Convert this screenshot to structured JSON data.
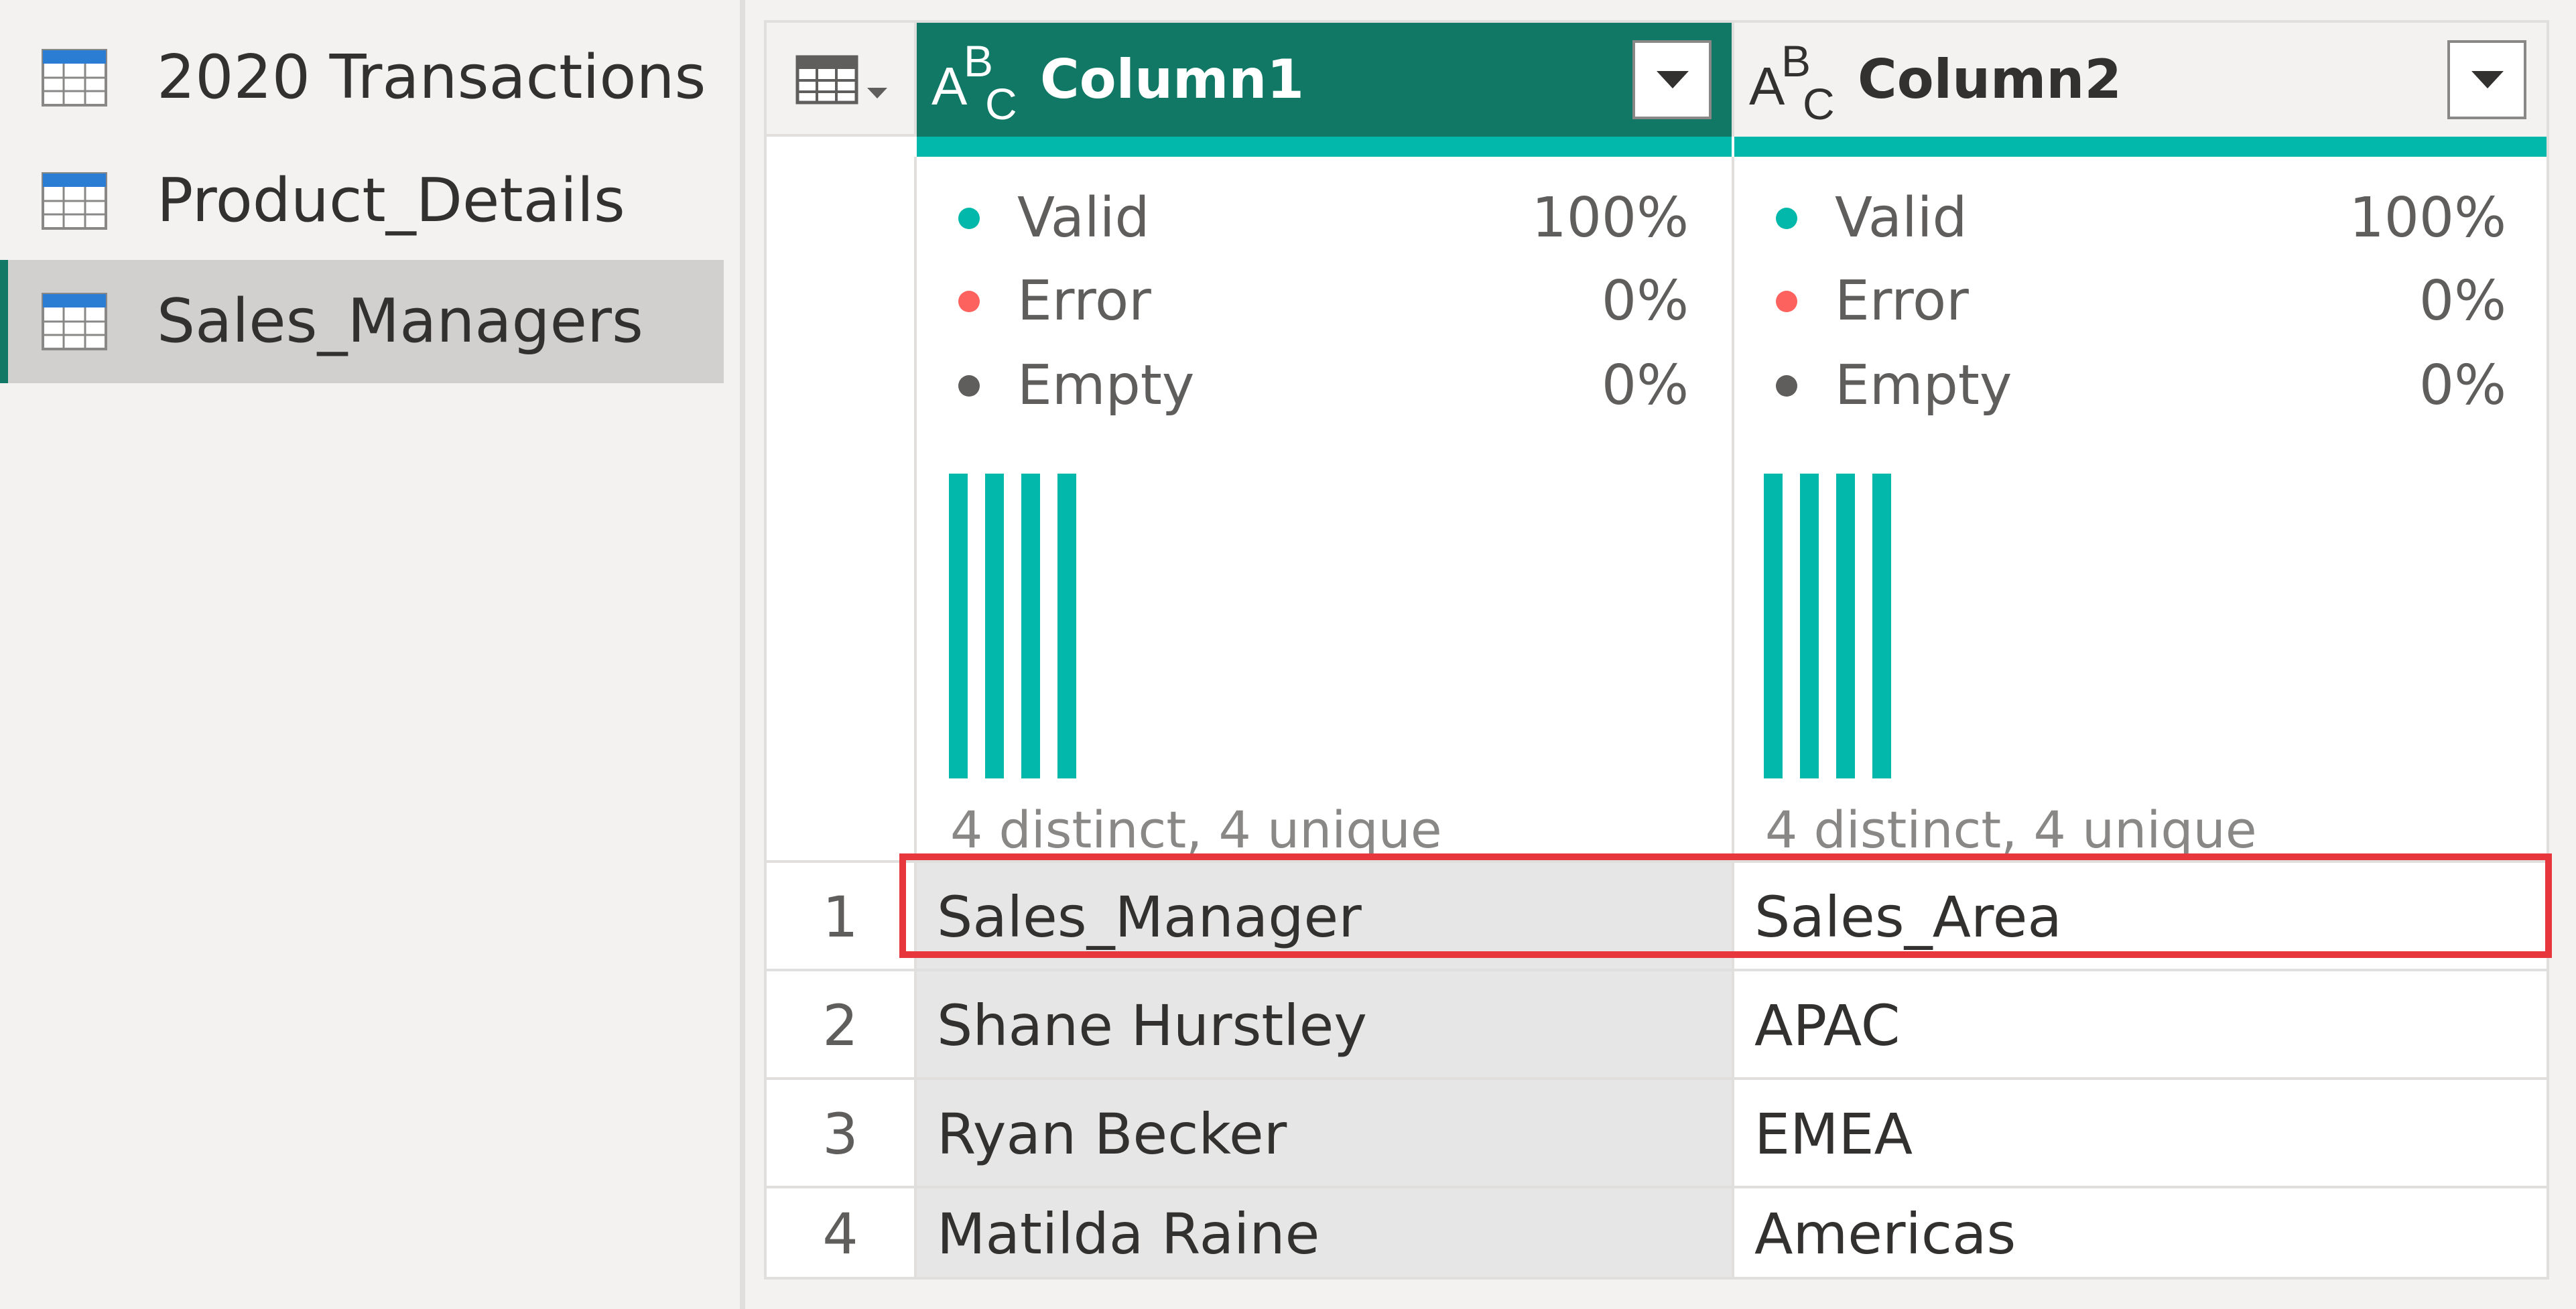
{
  "queries": [
    {
      "label": "2020 Transactions",
      "icon": "table-icon",
      "selected": false
    },
    {
      "label": "Product_Details",
      "icon": "table-icon",
      "selected": false
    },
    {
      "label": "Sales_Managers",
      "icon": "table-icon",
      "selected": true
    }
  ],
  "grid": {
    "corner_icon": "table-options-icon",
    "columns": [
      {
        "name": "Column1",
        "type_icon": "text-type-icon",
        "type_glyph": "ABC",
        "selected": true,
        "stats": {
          "valid_label": "Valid",
          "valid_value": "100%",
          "error_label": "Error",
          "error_value": "0%",
          "empty_label": "Empty",
          "empty_value": "0%"
        },
        "distribution_bar_count": 4,
        "distinct_text": "4 distinct, 4 unique"
      },
      {
        "name": "Column2",
        "type_icon": "text-type-icon",
        "type_glyph": "ABC",
        "selected": false,
        "stats": {
          "valid_label": "Valid",
          "valid_value": "100%",
          "error_label": "Error",
          "error_value": "0%",
          "empty_label": "Empty",
          "empty_value": "0%"
        },
        "distribution_bar_count": 4,
        "distinct_text": "4 distinct, 4 unique"
      }
    ],
    "rows": [
      {
        "num": "1",
        "c1": "Sales_Manager",
        "c2": "Sales_Area",
        "highlighted": true
      },
      {
        "num": "2",
        "c1": "Shane Hurstley",
        "c2": "APAC",
        "highlighted": false
      },
      {
        "num": "3",
        "c1": "Ryan Becker",
        "c2": "EMEA",
        "highlighted": false
      },
      {
        "num": "4",
        "c1": "Matilda Raine",
        "c2": "Americas",
        "highlighted": false
      }
    ]
  },
  "colors": {
    "accent": "#117865",
    "valid": "#01b8aa",
    "error": "#fd625e",
    "empty": "#605e5c",
    "highlight": "#e8363d"
  }
}
